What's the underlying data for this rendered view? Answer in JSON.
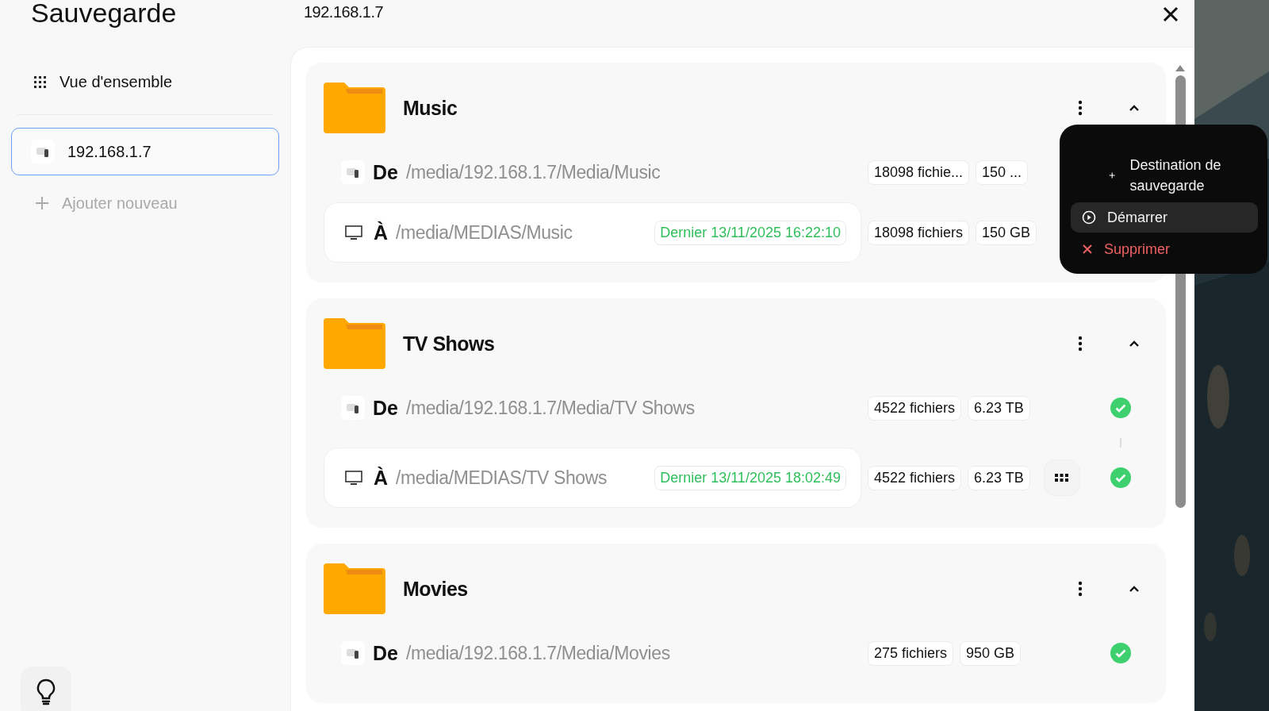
{
  "window": {
    "title": "Sauvegarde",
    "subtitle": "192.168.1.7"
  },
  "sidebar": {
    "overview": "Vue d'ensemble",
    "devices": [
      {
        "label": "192.168.1.7",
        "selected": true
      }
    ],
    "add": "Ajouter nouveau"
  },
  "groups": [
    {
      "name": "Music",
      "expanded": true,
      "source": {
        "label": "De",
        "path": "/media/192.168.1.7/Media/Music",
        "files": "18098 fichie...",
        "size": "150 ..."
      },
      "destination": {
        "label": "À",
        "path": "/media/MEDIAS/Music",
        "last_run": "Dernier 13/11/2025 16:22:10",
        "files": "18098 fichiers",
        "size": "150 GB"
      }
    },
    {
      "name": "TV Shows",
      "expanded": true,
      "source": {
        "label": "De",
        "path": "/media/192.168.1.7/Media/TV Shows",
        "files": "4522 fichiers",
        "size": "6.23 TB",
        "done": true
      },
      "destination": {
        "label": "À",
        "path": "/media/MEDIAS/TV Shows",
        "last_run": "Dernier 13/11/2025 18:02:49",
        "files": "4522 fichiers",
        "size": "6.23 TB",
        "options": true,
        "done": true
      }
    },
    {
      "name": "Movies",
      "expanded": true,
      "source": {
        "label": "De",
        "path": "/media/192.168.1.7/Media/Movies",
        "files": "275 fichiers",
        "size": "950 GB",
        "done": true
      }
    }
  ],
  "context_menu": {
    "items": [
      {
        "kind": "add",
        "label": "Destination de sauvegarde",
        "selected": false
      },
      {
        "kind": "start",
        "label": "Démarrer",
        "selected": true
      },
      {
        "kind": "delete",
        "label": "Supprimer",
        "selected": false
      }
    ]
  }
}
